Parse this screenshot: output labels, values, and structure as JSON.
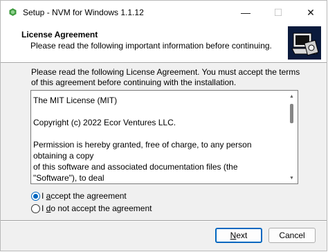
{
  "window": {
    "title": "Setup - NVM for Windows 1.1.12",
    "controls": {
      "minimize": "—",
      "maximize": "☐",
      "close": "✕"
    }
  },
  "header": {
    "title": "License Agreement",
    "subtitle": "Please read the following important information before continuing."
  },
  "intro": "Please read the following License Agreement. You must accept the terms of this agreement before continuing with the installation.",
  "license": {
    "text": "The MIT License (MIT)\n\nCopyright (c) 2022 Ecor Ventures LLC.\n\nPermission is hereby granted, free of charge, to any person obtaining a copy\nof this software and associated documentation files (the \"Software\"), to deal\nin the Software without restriction, including without limitation the rights\nto use, copy, modify, merge, publish, distribute, sublicense, and/or sell\ncopies of the Software, and to permit persons to whom the Software is"
  },
  "options": {
    "accept_prefix": "I ",
    "accept_hotkey": "a",
    "accept_suffix": "ccept the agreement",
    "decline_prefix": "I ",
    "decline_hotkey": "d",
    "decline_suffix": "o not accept the agreement",
    "selected": "accept"
  },
  "buttons": {
    "next_hotkey": "N",
    "next_suffix": "ext",
    "cancel": "Cancel"
  },
  "colors": {
    "accent": "#0067c0",
    "window_bg": "#f0f0f0"
  },
  "icons": {
    "app": "nvm-setup-icon",
    "logo": "installer-computer-icon"
  }
}
